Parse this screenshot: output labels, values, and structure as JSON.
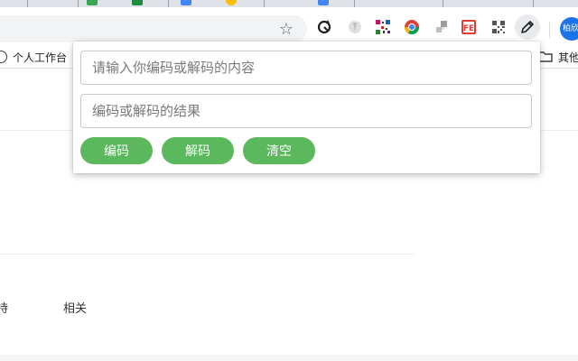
{
  "toolbar": {
    "bookmark_star": "☆",
    "extensions": [
      "refresh-icon",
      "extension-grey-icon",
      "qr-code-icon",
      "chrome-icon",
      "puzzle-icon",
      "fe-icon",
      "qr-code-icon",
      "pencil-icon"
    ],
    "fe_label": "FE",
    "profile_label": "柏欣"
  },
  "bookmarks": {
    "left_item": "个人工作台",
    "right_item": "其他"
  },
  "page": {
    "links": [
      "持",
      "相关"
    ]
  },
  "popup": {
    "input_placeholder": "请输入你编码或解码的内容",
    "output_placeholder": "编码或解码的结果",
    "encode_label": "编码",
    "decode_label": "解码",
    "clear_label": "清空",
    "button_color": "#5cb85c"
  }
}
